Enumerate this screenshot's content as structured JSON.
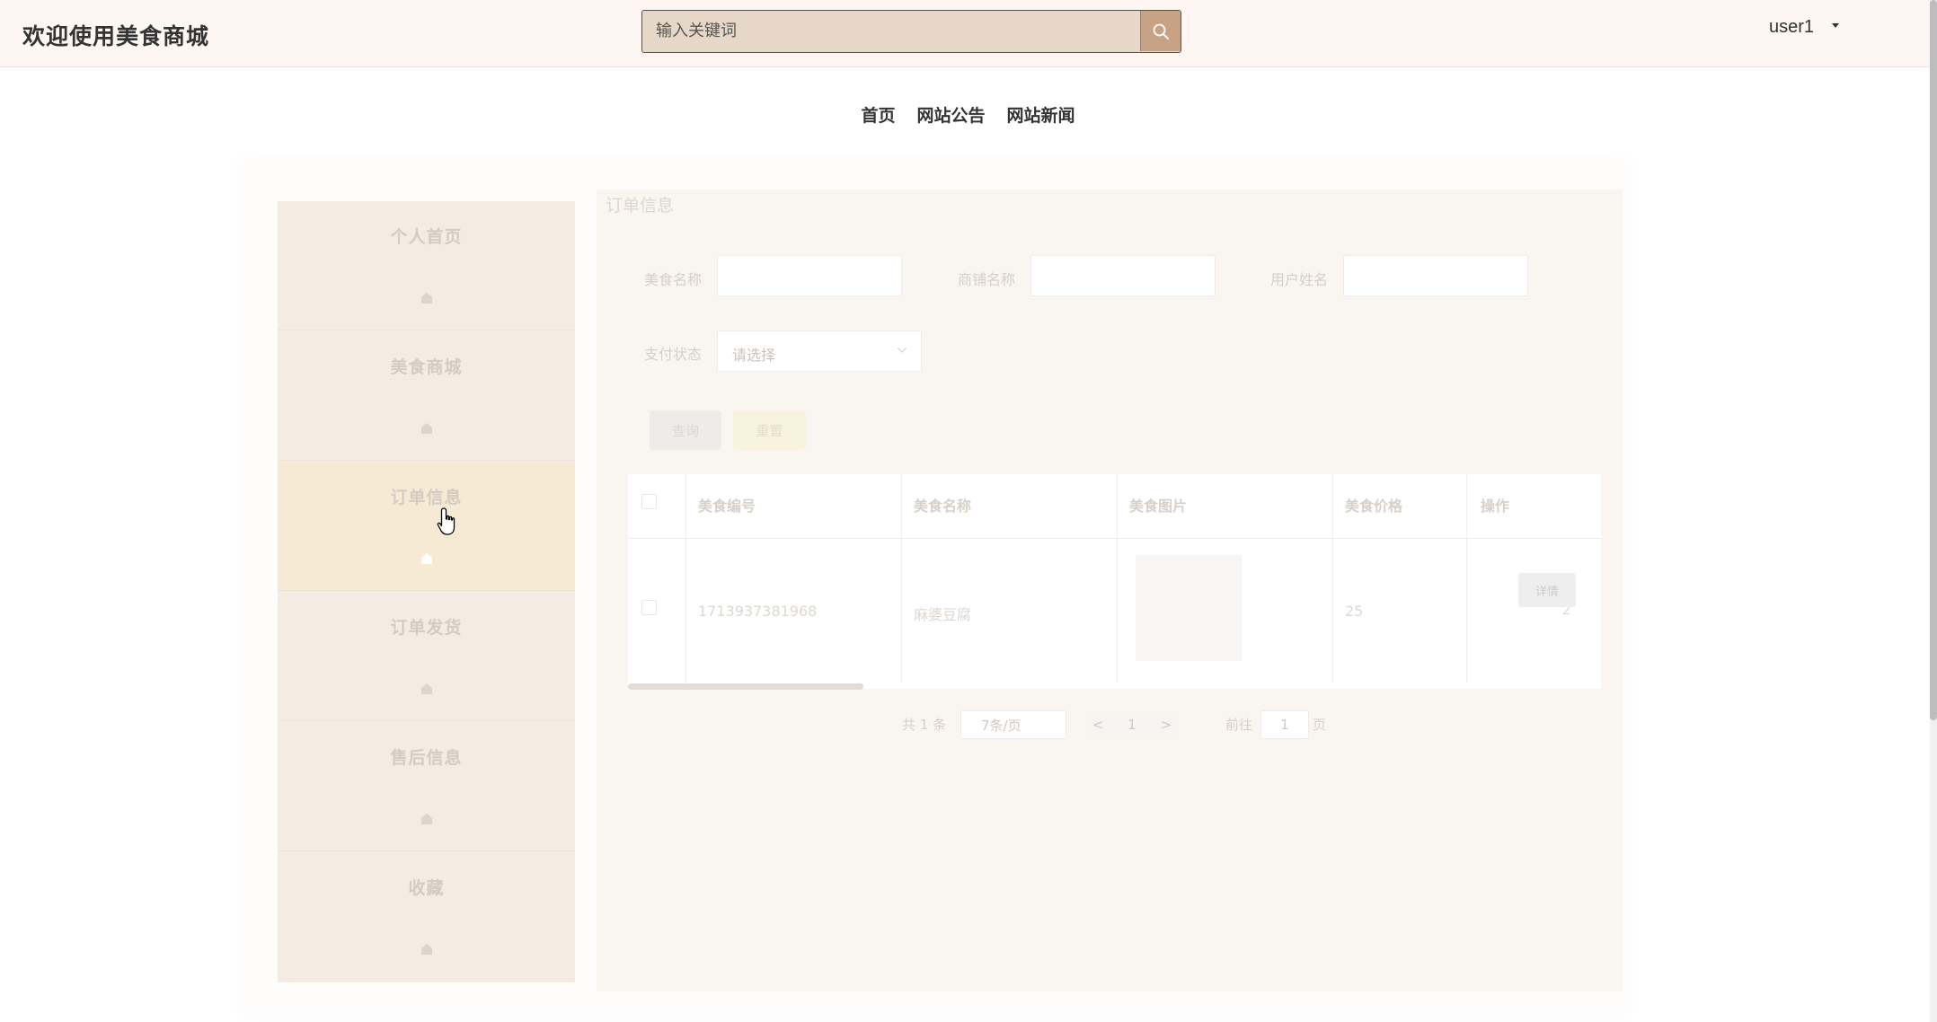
{
  "header": {
    "title": "欢迎使用美食商城",
    "search_placeholder": "输入关键词",
    "search_icon": "search-icon",
    "username": "user1"
  },
  "nav": {
    "items": [
      "首页",
      "网站公告",
      "网站新闻"
    ]
  },
  "sidebar": {
    "items": [
      {
        "label": "个人首页",
        "icon": "home-icon"
      },
      {
        "label": "美食商城",
        "icon": "home-icon"
      },
      {
        "label": "订单信息",
        "icon": "home-icon",
        "active": true
      },
      {
        "label": "订单发货",
        "icon": "home-icon"
      },
      {
        "label": "售后信息",
        "icon": "home-icon"
      },
      {
        "label": "收藏",
        "icon": "home-icon"
      }
    ]
  },
  "content": {
    "title": "订单信息",
    "filters": {
      "food_name_label": "美食名称",
      "shop_name_label": "商铺名称",
      "user_name_label": "用户姓名",
      "pay_status_label": "支付状态",
      "pay_status_placeholder": "请选择"
    },
    "buttons": {
      "query": "查询",
      "reset": "重置",
      "detail": "详情"
    },
    "table": {
      "columns": [
        "美食编号",
        "美食名称",
        "美食图片",
        "美食价格",
        "操作"
      ],
      "rows": [
        {
          "code": "1713937381968",
          "name": "麻婆豆腐",
          "price": "25",
          "extra": "2"
        }
      ]
    },
    "pagination": {
      "total": "共 1 条",
      "page_size": "7条/页",
      "prev": "<",
      "page": "1",
      "next": ">",
      "goto_label": "前往",
      "goto_value": "1",
      "goto_suffix": "页"
    }
  },
  "colors": {
    "topbar_bg": "#fdf6f3",
    "search_bg": "#e6d7c8",
    "search_button": "#c8a285",
    "sidebar_bg": "#f4ebe3",
    "sidebar_active": "#f6ead5"
  }
}
